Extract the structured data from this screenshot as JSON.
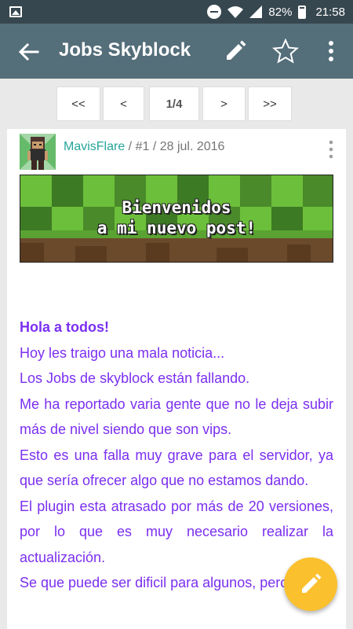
{
  "status_bar": {
    "battery": "82%",
    "time": "21:58",
    "icons": [
      "gallery-icon",
      "do-not-disturb-icon",
      "wifi-icon",
      "signal-icon",
      "battery-icon"
    ]
  },
  "app_bar": {
    "title": "Jobs Skyblock",
    "icons": [
      "back-arrow-icon",
      "edit-pencil-icon",
      "star-outline-icon",
      "more-vert-icon"
    ]
  },
  "pagination": {
    "first": "<<",
    "prev": "<",
    "current": "1/4",
    "next": ">",
    "last": ">>"
  },
  "post": {
    "author": "MavisFlare",
    "meta_rest": " / #1 / 28 jul. 2016",
    "banner_line1": "Bienvenidos",
    "banner_line2": "a mi nuevo post!",
    "greeting": "Hola a todos!",
    "lines": [
      "Hoy les traigo una mala noticia...",
      "Los Jobs de skyblock están fallando.",
      "Me ha reportado varia gente que no le deja subir más de nivel siendo que son vips.",
      "Esto es una falla muy grave para el servidor, ya que sería ofrecer algo que no estamos dando.",
      "El plugin esta atrasado por más de 20 versiones, por lo que es muy necesario realizar la actualización.",
      "Se que puede ser dificil para algunos, pero es"
    ]
  },
  "colors": {
    "status_bar": "#37474f",
    "app_bar": "#546e7a",
    "author_link": "#26a69a",
    "post_text": "#7b2ff0",
    "fab": "#fbc02d"
  }
}
